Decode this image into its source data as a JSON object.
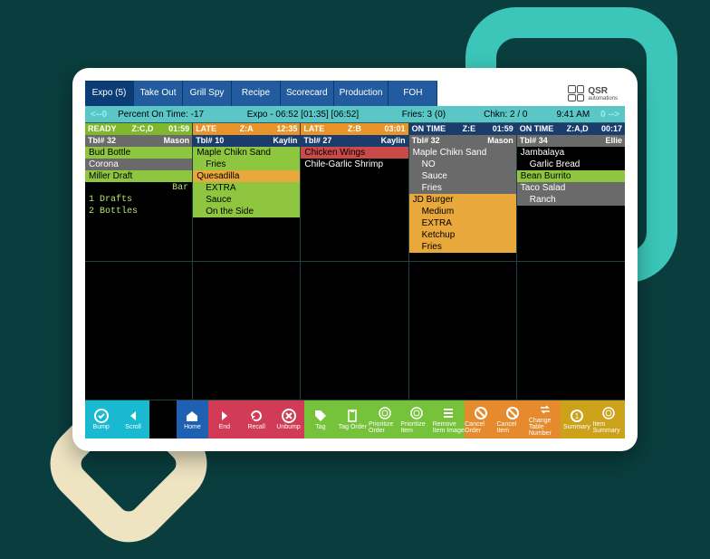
{
  "tabs": [
    "Expo (5)",
    "Take Out",
    "Grill Spy",
    "Recipe",
    "Scorecard",
    "Production",
    "FOH"
  ],
  "logo": {
    "brand": "QSR",
    "sub": "automations"
  },
  "status": {
    "left_arrow": "<--0",
    "percent": "Percent On Time: -17",
    "expo": "Expo   - 06:52  [01:35]  [06:52]",
    "fries": "Fries: 3  (0)",
    "chkn": "Chkn: 2 / 0",
    "time": "9:41 AM",
    "right_arrow": "0 -->"
  },
  "columns": [
    {
      "hdr1": {
        "status": "READY",
        "zone": "Z:C,D",
        "time": "01:59",
        "cls": "hdr-ready hdr-green"
      },
      "hdr2": {
        "table": "Tbl# 32",
        "server": "Mason",
        "cls": "sub-gray"
      },
      "items": [
        {
          "t": "Bud Bottle",
          "cls": "green"
        },
        {
          "t": "Corona",
          "cls": "gray"
        },
        {
          "t": "Miller Draft",
          "cls": "green"
        },
        {
          "t": "Bar",
          "cls": "barhead"
        },
        {
          "t": "1 Drafts",
          "cls": "bar"
        },
        {
          "t": "2 Bottles",
          "cls": "bar"
        }
      ]
    },
    {
      "hdr1": {
        "status": "LATE",
        "zone": "Z:A",
        "time": "12:35",
        "cls": "hdr-late hdr-orange"
      },
      "hdr2": {
        "table": "Tbl# 10",
        "server": "Kaylin",
        "cls": "hdr-blue"
      },
      "items": [
        {
          "t": "Maple Chikn Sand",
          "cls": "green"
        },
        {
          "t": "Fries",
          "cls": "green indent"
        },
        {
          "t": "Quesadilla",
          "cls": "orange"
        },
        {
          "t": "EXTRA",
          "cls": "green indent"
        },
        {
          "t": "Sauce",
          "cls": "green indent"
        },
        {
          "t": "On the Side",
          "cls": "green indent"
        }
      ]
    },
    {
      "hdr1": {
        "status": "LATE",
        "zone": "Z:B",
        "time": "03:01",
        "cls": "hdr-late hdr-orange"
      },
      "hdr2": {
        "table": "Tbl# 27",
        "server": "Kaylin",
        "cls": "hdr-blue"
      },
      "items": [
        {
          "t": "Chicken Wings",
          "cls": "red"
        },
        {
          "t": "Chile-Garlic Shrimp",
          "cls": "black"
        }
      ]
    },
    {
      "hdr1": {
        "status": "ON TIME",
        "zone": "Z:E",
        "time": "01:59",
        "cls": "hdr-blue"
      },
      "hdr2": {
        "table": "Tbl# 32",
        "server": "Mason",
        "cls": "sub-gray"
      },
      "items": [
        {
          "t": "Maple Chikn Sand",
          "cls": "gray"
        },
        {
          "t": "NO",
          "cls": "gray indent"
        },
        {
          "t": "Sauce",
          "cls": "gray indent"
        },
        {
          "t": "Fries",
          "cls": "gray indent"
        },
        {
          "t": "JD Burger",
          "cls": "orange"
        },
        {
          "t": "Medium",
          "cls": "orange indent"
        },
        {
          "t": "EXTRA",
          "cls": "orange indent"
        },
        {
          "t": "Ketchup",
          "cls": "orange indent"
        },
        {
          "t": "Fries",
          "cls": "orange indent"
        }
      ]
    },
    {
      "hdr1": {
        "status": "ON TIME",
        "zone": "Z:A,D",
        "time": "00:17",
        "cls": "hdr-blue"
      },
      "hdr2": {
        "table": "Tbl# 34",
        "server": "Ellie",
        "cls": "sub-gray"
      },
      "items": [
        {
          "t": "Jambalaya",
          "cls": "black"
        },
        {
          "t": "Garlic Bread",
          "cls": "black indent"
        },
        {
          "t": "Bean Burrito",
          "cls": "green"
        },
        {
          "t": "Taco Salad",
          "cls": "gray"
        },
        {
          "t": "Ranch",
          "cls": "gray indent"
        }
      ]
    }
  ],
  "toolbar": [
    {
      "label": "Bump",
      "color": "c-cyan",
      "icon": "check"
    },
    {
      "label": "Scroll",
      "color": "c-cyan",
      "icon": "left"
    },
    {
      "gap": true
    },
    {
      "label": "Home",
      "color": "c-blue",
      "icon": "home"
    },
    {
      "label": "End",
      "color": "c-red",
      "icon": "end"
    },
    {
      "label": "Recall",
      "color": "c-red",
      "icon": "refresh"
    },
    {
      "label": "Unbump",
      "color": "c-red",
      "icon": "uncheck"
    },
    {
      "label": "Tag",
      "color": "c-green",
      "icon": "tag"
    },
    {
      "label": "Tag Order",
      "color": "c-green",
      "icon": "clipboard"
    },
    {
      "label": "Prioritize Order",
      "color": "c-green",
      "icon": "plate"
    },
    {
      "label": "Prioritize Item",
      "color": "c-green",
      "icon": "plate"
    },
    {
      "label": "Remove Item Image",
      "color": "c-green",
      "icon": "bars"
    },
    {
      "label": "Cancel Order",
      "color": "c-orange",
      "icon": "cancel"
    },
    {
      "label": "Cancel Item",
      "color": "c-orange",
      "icon": "cancel"
    },
    {
      "label": "Change Table Number",
      "color": "c-orange",
      "icon": "swap"
    },
    {
      "label": "Summary",
      "color": "c-gold",
      "icon": "sum"
    },
    {
      "label": "Item Summary",
      "color": "c-gold",
      "icon": "plate"
    }
  ]
}
